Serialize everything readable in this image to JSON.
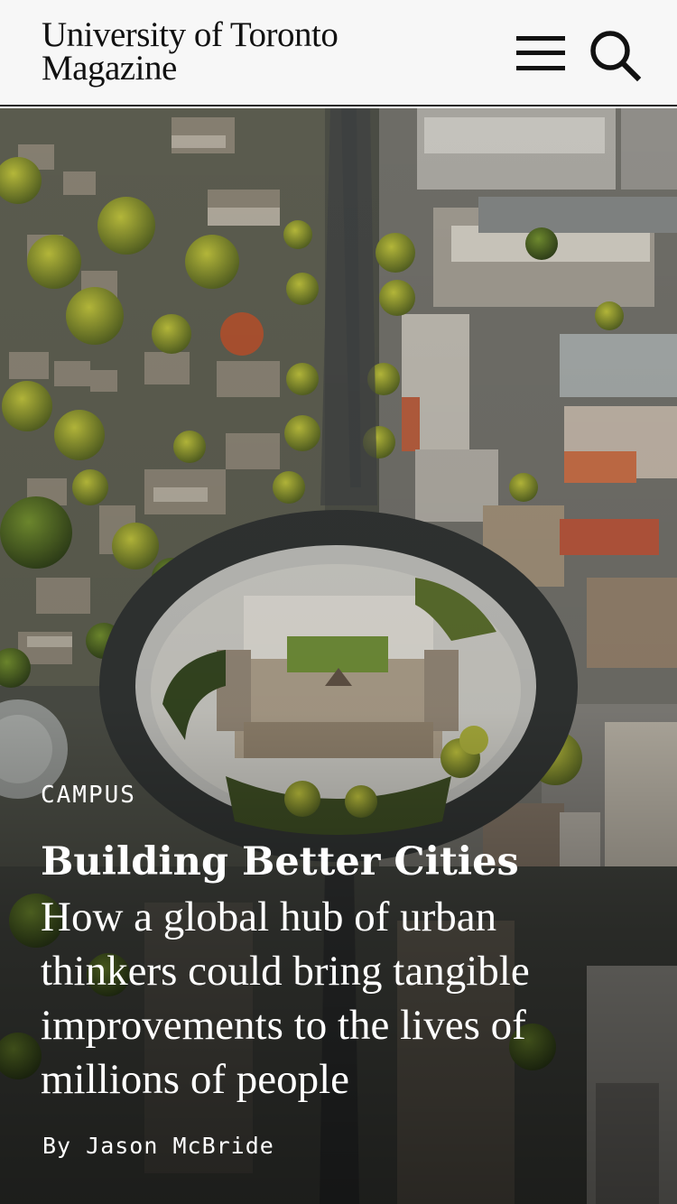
{
  "header": {
    "logo_line1": "University of Toronto",
    "logo_line2": "Magazine",
    "menu_icon": "hamburger-menu-icon",
    "search_icon": "search-icon"
  },
  "hero": {
    "image_description_icon": "aerial-photo",
    "category": "CAMPUS",
    "headline": "Building Better Cities",
    "dek": "How a global hub of urban thinkers could bring tangible improvements to the lives of millions of people",
    "byline": "By Jason McBride"
  },
  "colors": {
    "header_bg": "#f7f7f7",
    "text_dark": "#111111",
    "text_light": "#ffffff"
  }
}
